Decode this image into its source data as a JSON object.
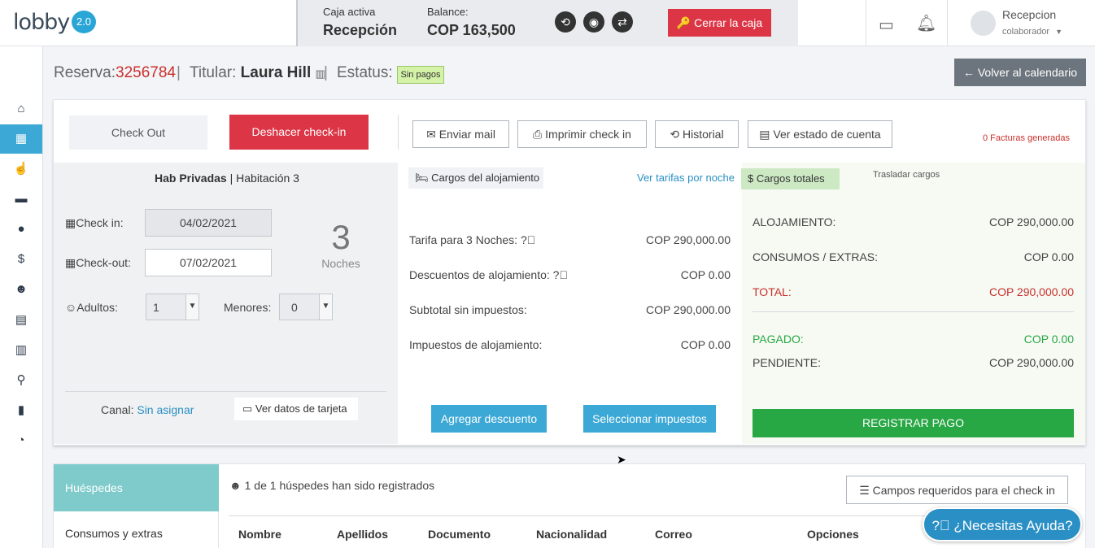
{
  "app": {
    "logo_text": "lobby",
    "version": "2.0"
  },
  "cashbox": {
    "active_label": "Caja activa",
    "active_value": "Recepción",
    "balance_label": "Balance:",
    "balance_value": "COP 163,500",
    "close_label": "Cerrar la caja"
  },
  "user": {
    "name": "Recepcion",
    "role": "colaborador"
  },
  "sidebar": {
    "items": [
      {
        "name": "home",
        "icon": "home-icon"
      },
      {
        "name": "calendar",
        "icon": "calendar-icon",
        "active": true
      },
      {
        "name": "hand",
        "icon": "hand-pointer-icon"
      },
      {
        "name": "archive",
        "icon": "archive-icon"
      },
      {
        "name": "location",
        "icon": "map-marker-icon"
      },
      {
        "name": "dollar",
        "icon": "dollar-icon"
      },
      {
        "name": "users",
        "icon": "users-icon"
      },
      {
        "name": "contacts",
        "icon": "address-book-icon"
      },
      {
        "name": "clipboard",
        "icon": "clipboard-icon"
      },
      {
        "name": "search",
        "icon": "search-icon"
      },
      {
        "name": "reports",
        "icon": "bar-chart-icon"
      },
      {
        "name": "stats",
        "icon": "pie-chart-icon"
      }
    ]
  },
  "header": {
    "reserva_label": "Reserva:",
    "reserva_value": "3256784",
    "titular_label": "Titular:",
    "titular_value": "Laura Hill",
    "status_label": "Estatus:",
    "status_value": "Sin pagos",
    "back_label": "Volver al calendario"
  },
  "actions": {
    "checkout": "Check Out",
    "undo_checkin": "Deshacer check-in",
    "send_mail": "Enviar mail",
    "print_checkin": "Imprimir check in",
    "history": "Historial",
    "account_state": "Ver estado de cuenta",
    "invoices": "0 Facturas generadas"
  },
  "room": {
    "type": "Hab Privadas",
    "name": "Habitación 3",
    "checkin_label": "Check in:",
    "checkin_value": "04/02/2021",
    "checkout_label": "Check-out:",
    "checkout_value": "07/02/2021",
    "nights_count": "3",
    "nights_label": "Noches",
    "adults_label": "Adultos:",
    "adults_value": "1",
    "minors_label": "Menores:",
    "minors_value": "0",
    "channel_label": "Canal:",
    "channel_value": "Sin asignar",
    "card_label": "Ver datos de tarjeta"
  },
  "charges": {
    "tab_label": "Cargos del alojamiento",
    "rates_link": "Ver tarifas por noche",
    "rows": [
      {
        "label": "Tarifa para 3 Noches:",
        "value": "COP 290,000.00",
        "help": true
      },
      {
        "label": "Descuentos de alojamiento:",
        "value": "COP 0.00",
        "help": true
      },
      {
        "label": "Subtotal sin impuestos:",
        "value": "COP 290,000.00",
        "help": false
      },
      {
        "label": "Impuestos de alojamiento:",
        "value": "COP 0.00",
        "help": false
      }
    ],
    "add_discount": "Agregar descuento",
    "select_taxes": "Seleccionar impuestos"
  },
  "totals": {
    "tab_label": "Cargos totales",
    "transfer_label": "Trasladar cargos",
    "lodging_label": "ALOJAMIENTO:",
    "lodging_value": "COP 290,000.00",
    "extras_label": "CONSUMOS / EXTRAS:",
    "extras_value": "COP 0.00",
    "total_label": "TOTAL:",
    "total_value": "COP 290,000.00",
    "paid_label": "PAGADO:",
    "paid_value": "COP 0.00",
    "pending_label": "PENDIENTE:",
    "pending_value": "COP 290,000.00",
    "register_payment": "REGISTRAR PAGO"
  },
  "guests": {
    "tab_active": "Huéspedes",
    "tab_other": "Consumos y extras",
    "registered_text": "1 de 1 húspedes han sido registrados",
    "required_fields": "Campos requeridos para el check in",
    "columns": [
      "Nombre",
      "Apellidos",
      "Documento",
      "Nacionalidad",
      "Correo",
      "Opciones"
    ]
  },
  "help": {
    "label": "¿Necesitas Ayuda?"
  },
  "colors": {
    "accent": "#3ba8d6",
    "danger": "#dc3545",
    "success": "#28a745",
    "teal": "#7fcbcb"
  }
}
